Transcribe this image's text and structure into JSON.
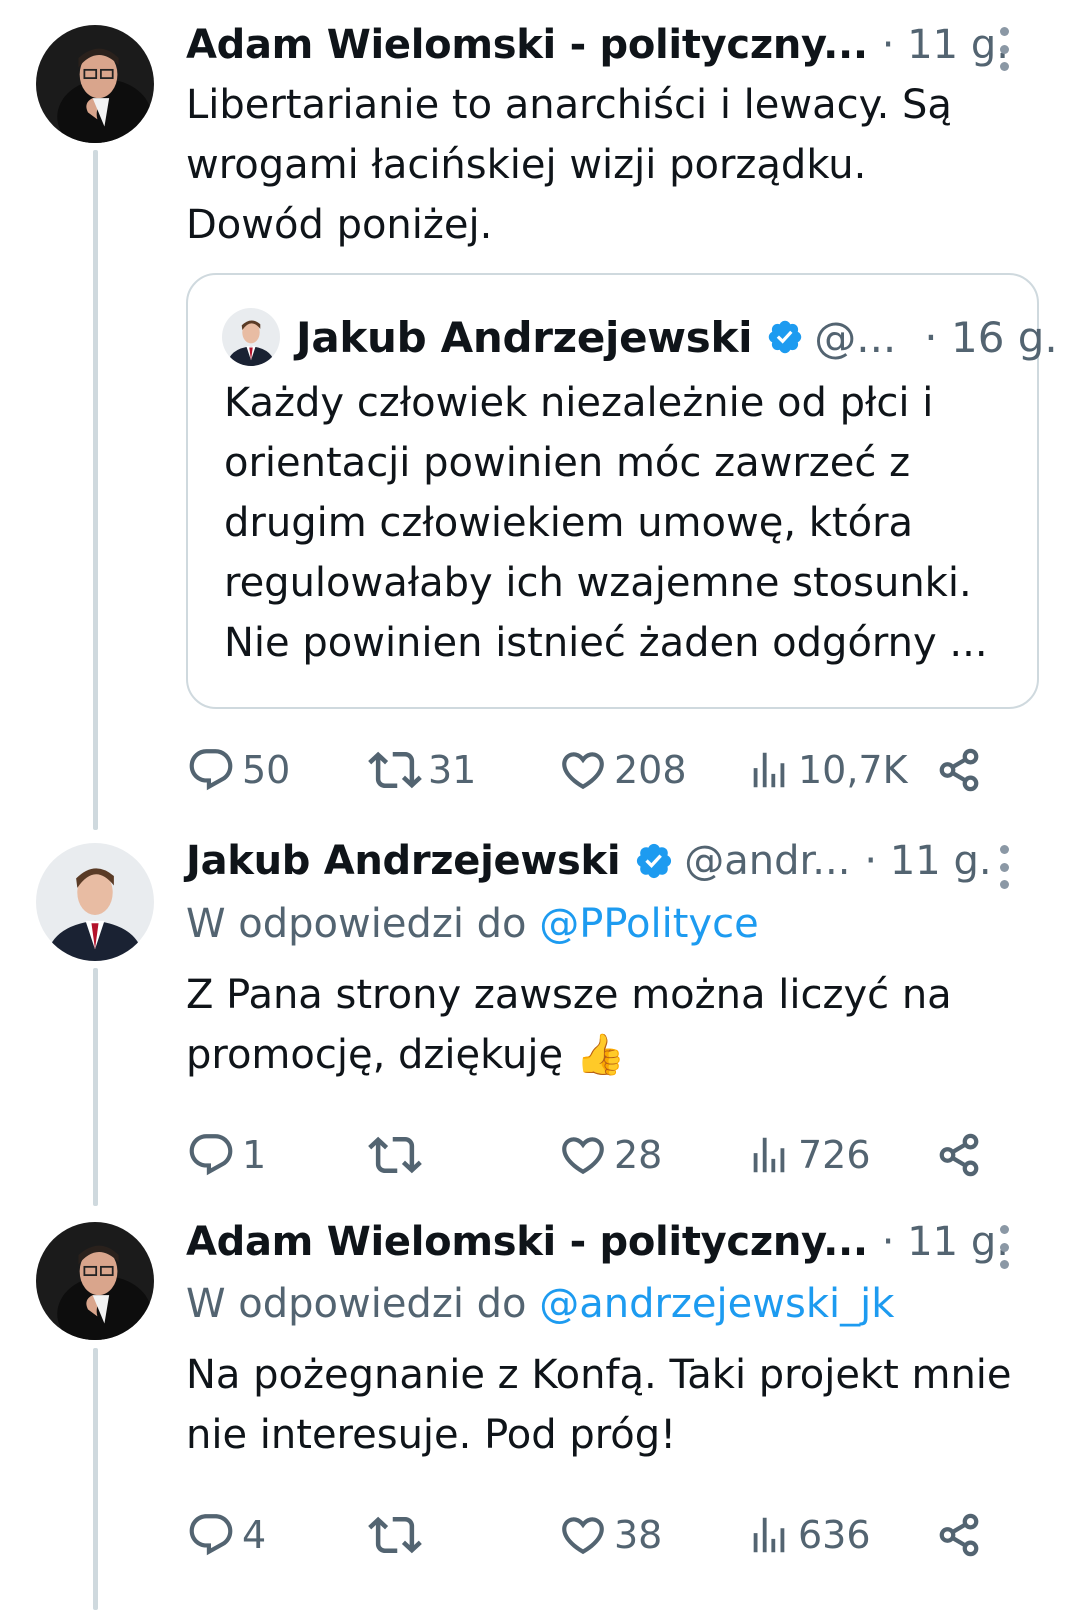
{
  "colors": {
    "text": "#0f1419",
    "muted": "#536471",
    "link": "#1d9bf0",
    "verified": "#1d9bf0",
    "border": "#cfd9de"
  },
  "tweet1": {
    "name": "Adam Wielomski - polityczny...",
    "time": "· 11 g.",
    "text": [
      "Libertarianie to anarchiści i lewacy. Są",
      "wrogami łacińskiej wizji porządku.",
      "Dowód poniżej."
    ],
    "quote": {
      "name": "Jakub Andrzejewski",
      "handle": "@...",
      "time": "· 16 g.",
      "text": [
        "Każdy człowiek niezależnie od płci i",
        "orientacji powinien móc zawrzeć z",
        "drugim człowiekiem umowę, która",
        "regulowałaby ich wzajemne stosunki.",
        "Nie powinien istnieć żaden odgórny ..."
      ]
    },
    "actions": {
      "replies": "50",
      "retweets": "31",
      "likes": "208",
      "views": "10,7K"
    }
  },
  "tweet2": {
    "name": "Jakub Andrzejewski",
    "handle": "@andr...",
    "time": "· 11 g.",
    "reply_prefix": "W odpowiedzi do ",
    "reply_mention": "@PPolityce",
    "text": [
      "Z Pana strony zawsze można liczyć na",
      "promocję, dziękuję 👍"
    ],
    "actions": {
      "replies": "1",
      "retweets": "",
      "likes": "28",
      "views": "726"
    }
  },
  "tweet3": {
    "name": "Adam Wielomski - polityczny...",
    "time": "· 11 g.",
    "reply_prefix": "W odpowiedzi do ",
    "reply_mention": "@andrzejewski_jk",
    "text": [
      "Na pożegnanie z Konfą. Taki projekt mnie",
      "nie interesuje. Pod próg!"
    ],
    "actions": {
      "replies": "4",
      "retweets": "",
      "likes": "38",
      "views": "636"
    }
  }
}
